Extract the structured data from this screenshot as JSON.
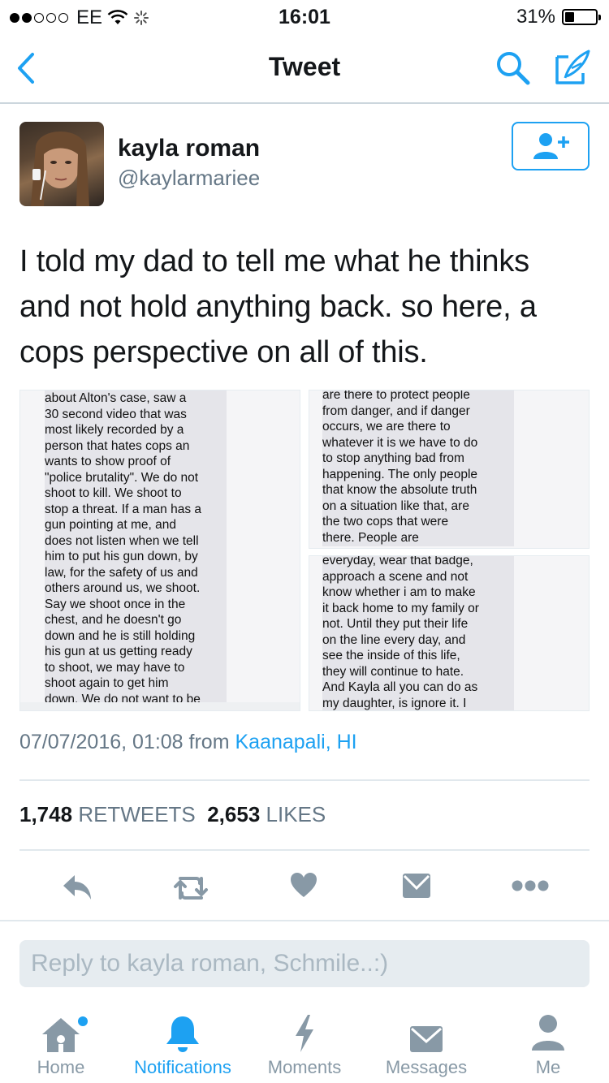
{
  "status_bar": {
    "carrier": "EE",
    "time": "16:01",
    "battery": "31%",
    "battery_level": 0.31
  },
  "nav": {
    "title": "Tweet"
  },
  "tweet": {
    "author_name": "kayla roman",
    "author_handle": "@kaylarmariee",
    "text": "I told my dad to tell me what he thinks and not hold anything back. so here, a cops perspective on all of this.",
    "timestamp": "07/07/2016, 01:08 from",
    "location": "Kaanapali, HI",
    "retweets_count": "1,748",
    "retweets_label": "RETWEETS",
    "likes_count": "2,653",
    "likes_label": "LIKES"
  },
  "images": {
    "left_text": "about Alton's case, saw a\n30 second video that was\nmost likely recorded by a\nperson that hates cops an\nwants to show proof of\n\"police brutality\". We do not\nshoot to kill. We shoot to\nstop a threat. If a man has a\ngun pointing at me, and\ndoes not listen when we tell\nhim to put his gun down, by\nlaw, for the safety of us and\nothers around us, we shoot.\nSay we shoot once in the\nchest, and he doesn't go\ndown and he is still holding\nhis gun at us getting ready\nto shoot, we may have to\nshoot again to get him\ndown. We do not want to be",
    "top_right_text": "are there to protect people\nfrom danger, and if danger\noccurs, we are there to\nwhatever it is we have to do\nto stop anything bad from\nhappening. The only people\nthat know the absolute truth\non a situation like that, are\nthe two cops that were\nthere. People are",
    "bottom_right_text": "everyday, wear that badge,\napproach a scene and not\nknow whether i am to make\nit back home to my family or\nnot. Until they put their life\non the line every day, and\nsee the inside of this life,\nthey will continue to hate.\nAnd Kayla all you can do as\nmy daughter, is ignore it. I"
  },
  "reply": {
    "placeholder": "Reply to kayla roman, Schmile..:)"
  },
  "tabs": [
    {
      "label": "Home",
      "icon": "home-icon"
    },
    {
      "label": "Notifications",
      "icon": "bell-icon"
    },
    {
      "label": "Moments",
      "icon": "lightning-icon"
    },
    {
      "label": "Messages",
      "icon": "envelope-icon"
    },
    {
      "label": "Me",
      "icon": "person-icon"
    }
  ],
  "colors": {
    "accent": "#1da1f2",
    "muted": "#657786",
    "icon_gray": "#8899a6"
  }
}
